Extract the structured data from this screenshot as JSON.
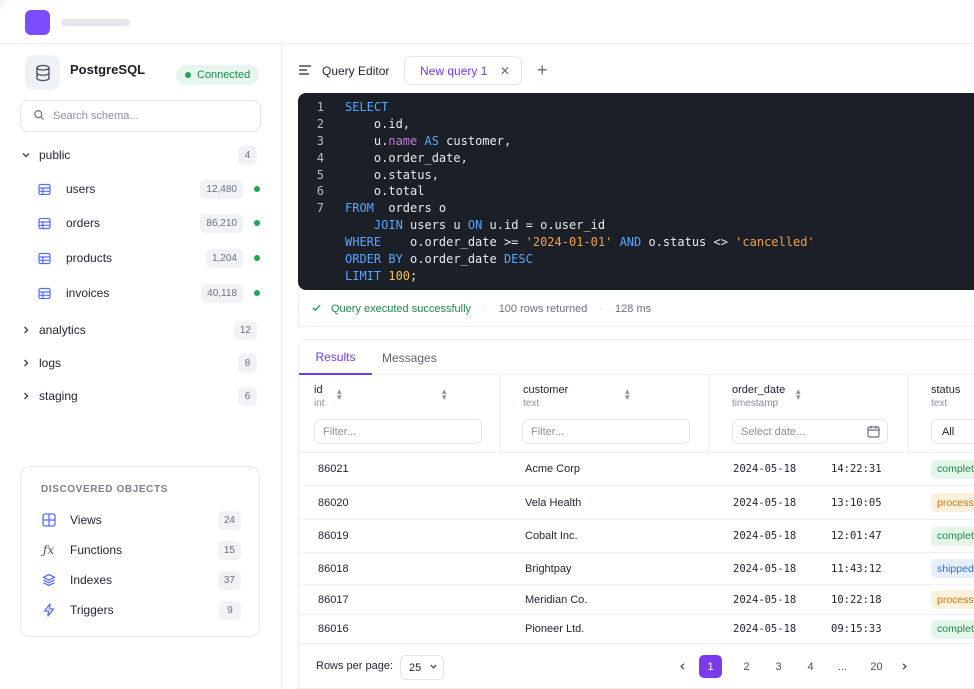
{
  "sidebar": {
    "db_name": "PostgreSQL",
    "connection_status": "Connected",
    "search_placeholder": "Search schema...",
    "schemas": [
      {
        "name": "public",
        "count": "4",
        "expanded": true,
        "tables": [
          {
            "name": "users",
            "rows": "12,480"
          },
          {
            "name": "orders",
            "rows": "86,210"
          },
          {
            "name": "products",
            "rows": "1,204"
          },
          {
            "name": "invoices",
            "rows": "40,118"
          }
        ]
      },
      {
        "name": "analytics",
        "count": "12",
        "expanded": false
      },
      {
        "name": "logs",
        "count": "8",
        "expanded": false
      },
      {
        "name": "staging",
        "count": "6",
        "expanded": false
      }
    ],
    "discovered": {
      "title": "DISCOVERED OBJECTS",
      "items": [
        {
          "label": "Views",
          "count": "24",
          "icon": "grid-icon"
        },
        {
          "label": "Functions",
          "count": "15",
          "icon": "function-icon"
        },
        {
          "label": "Indexes",
          "count": "37",
          "icon": "layers-icon"
        },
        {
          "label": "Triggers",
          "count": "9",
          "icon": "bolt-icon"
        }
      ]
    }
  },
  "editor": {
    "label": "Query Editor",
    "tab_label": "New query 1",
    "line_numbers": [
      "1",
      "2",
      "3",
      "4",
      "5",
      "6",
      "7"
    ],
    "lines": [
      [
        [
          "kw",
          "SELECT"
        ]
      ],
      [
        [
          "t",
          "    o.id,"
        ]
      ],
      [
        [
          "t",
          "    u."
        ],
        [
          "fn",
          "name"
        ],
        [
          "t",
          " "
        ],
        [
          "kw",
          "AS"
        ],
        [
          "t",
          " customer,"
        ]
      ],
      [
        [
          "t",
          "    o.order_date,"
        ]
      ],
      [
        [
          "t",
          "    o.status,"
        ]
      ],
      [
        [
          "t",
          "    o.total"
        ]
      ],
      [
        [
          "kw",
          "FROM"
        ],
        [
          "t",
          "  orders o"
        ]
      ],
      [
        [
          "t",
          "    "
        ],
        [
          "kw",
          "JOIN"
        ],
        [
          "t",
          " users u "
        ],
        [
          "kw",
          "ON"
        ],
        [
          "t",
          " u.id = o.user_id"
        ]
      ],
      [
        [
          "kw",
          "WHERE"
        ],
        [
          "t",
          "    o.order_date >= "
        ],
        [
          "str",
          "'2024-01-01'"
        ],
        [
          "t",
          " "
        ],
        [
          "kw",
          "AND"
        ],
        [
          "t",
          " o.status <> "
        ],
        [
          "str",
          "'cancelled'"
        ]
      ],
      [
        [
          "kw",
          "ORDER BY"
        ],
        [
          "t",
          " o.order_date "
        ],
        [
          "kw",
          "DESC"
        ]
      ],
      [
        [
          "kw",
          "LIMIT"
        ],
        [
          "t",
          " "
        ],
        [
          "num",
          "100"
        ],
        [
          "t",
          ";"
        ]
      ]
    ]
  },
  "status": {
    "message": "Query executed successfully",
    "rows": "100 rows returned",
    "time": "128 ms"
  },
  "results": {
    "tabs": [
      "Results",
      "Messages"
    ],
    "columns": [
      {
        "name": "id",
        "type": "int",
        "filter_placeholder": "Filter..."
      },
      {
        "name": "customer",
        "type": "text",
        "filter_placeholder": "Filter..."
      },
      {
        "name": "order_date",
        "type": "timestamp",
        "filter_placeholder": "Select date..."
      },
      {
        "name": "status",
        "type": "text",
        "filter_value": "All"
      }
    ],
    "rows": [
      {
        "id": "86021",
        "customer": "Acme Corp",
        "date": "2024-05-18",
        "time": "14:22:31",
        "status": "complet",
        "status_kind": "completed"
      },
      {
        "id": "86020",
        "customer": "Vela Health",
        "date": "2024-05-18",
        "time": "13:10:05",
        "status": "process",
        "status_kind": "processing"
      },
      {
        "id": "86019",
        "customer": "Cobalt Inc.",
        "date": "2024-05-18",
        "time": "12:01:47",
        "status": "complet",
        "status_kind": "completed"
      },
      {
        "id": "86018",
        "customer": "Brightpay",
        "date": "2024-05-18",
        "time": "11:43:12",
        "status": "shipped",
        "status_kind": "shipped"
      },
      {
        "id": "86017",
        "customer": "Meridian Co.",
        "date": "2024-05-18",
        "time": "10:22:18",
        "status": "process",
        "status_kind": "processing"
      },
      {
        "id": "86016",
        "customer": "Pioneer Ltd.",
        "date": "2024-05-18",
        "time": "09:15:33",
        "status": "complet",
        "status_kind": "completed"
      }
    ],
    "rows_per_page_label": "Rows per page:",
    "rows_per_page": "25",
    "pages": [
      "1",
      "2",
      "3",
      "4",
      "...",
      "20"
    ],
    "current_page": "1"
  },
  "colors": {
    "accent": "#7c3aed",
    "success": "#22a65a",
    "code_bg": "#1b1f27",
    "status_completed_bg": "#e4f6ea",
    "status_completed_fg": "#1f8a4c",
    "status_processing_bg": "#fdf0dc",
    "status_processing_fg": "#c27a12",
    "status_shipped_bg": "#e6efff",
    "status_shipped_fg": "#2f6fe0"
  }
}
